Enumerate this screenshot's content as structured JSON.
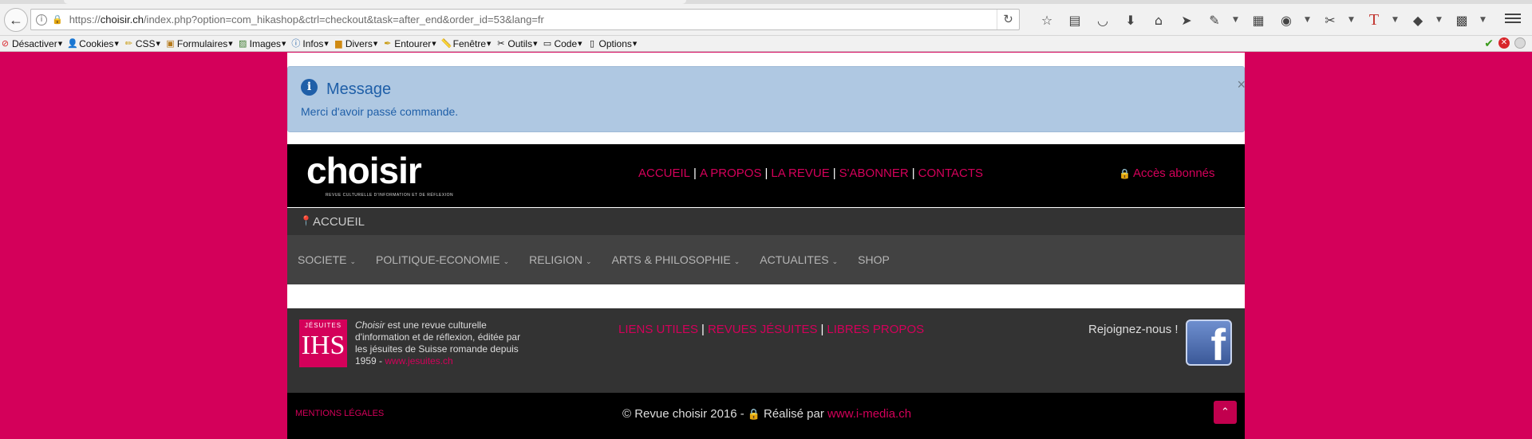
{
  "browser": {
    "url_prefix": "https://",
    "url_domain": "choisir.ch",
    "url_rest": "/index.php?option=com_hikashop&ctrl=checkout&task=after_end&order_id=53&lang=fr",
    "bookmarks": [
      {
        "label": "Désactiver",
        "icon": "no-entry-icon"
      },
      {
        "label": "Cookies",
        "icon": "person-icon"
      },
      {
        "label": "CSS",
        "icon": "pencil-icon"
      },
      {
        "label": "Formulaires",
        "icon": "clipboard-icon"
      },
      {
        "label": "Images",
        "icon": "picture-icon"
      },
      {
        "label": "Infos",
        "icon": "info-icon"
      },
      {
        "label": "Divers",
        "icon": "folder-icon"
      },
      {
        "label": "Entourer",
        "icon": "pen-icon"
      },
      {
        "label": "Fenêtre",
        "icon": "ruler-icon"
      },
      {
        "label": "Outils",
        "icon": "tools-icon"
      },
      {
        "label": "Code",
        "icon": "monitor-icon"
      },
      {
        "label": "Options",
        "icon": "options-icon"
      }
    ]
  },
  "alert": {
    "title": "Message",
    "text": "Merci d'avoir passé commande.",
    "close": "×"
  },
  "header": {
    "logo": "choisir",
    "logo_sub": "REVUE CULTURELLE D'INFORMATION ET DE RÉFLEXION",
    "nav": [
      "ACCUEIL",
      "A PROPOS",
      "LA REVUE",
      "S'ABONNER",
      "CONTACTS"
    ],
    "login": "Accès abonnés"
  },
  "breadcrumb": {
    "current": "ACCUEIL"
  },
  "main_nav": [
    {
      "label": "SOCIETE",
      "dropdown": true
    },
    {
      "label": "POLITIQUE-ECONOMIE",
      "dropdown": true
    },
    {
      "label": "RELIGION",
      "dropdown": true
    },
    {
      "label": "ARTS & PHILOSOPHIE",
      "dropdown": true
    },
    {
      "label": "ACTUALITES",
      "dropdown": true
    },
    {
      "label": "SHOP",
      "dropdown": false
    }
  ],
  "footer": {
    "jesuites_top": "JÉSUITES",
    "jesuites_ihs": "IHS",
    "blurb_italic": "Choisir",
    "blurb_text": " est une revue culturelle d'information et de réflexion, éditée par les jésuites de Suisse romande depuis 1959 - ",
    "blurb_link": "www.jesuites.ch",
    "links": [
      "LIENS UTILES",
      "REVUES JÉSUITES",
      "LIBRES PROPOS"
    ],
    "join": "Rejoignez-nous !",
    "facebook": "f",
    "legal": "MENTIONS LÉGALES",
    "copyright_pre": "© Revue choisir 2016 -",
    "copyright_mid": "Réalisé par",
    "copyright_link": "www.i-media.ch"
  },
  "colors": {
    "brand": "#d4005a",
    "alert_bg": "#afc8e2",
    "alert_text": "#1f5fa8"
  }
}
